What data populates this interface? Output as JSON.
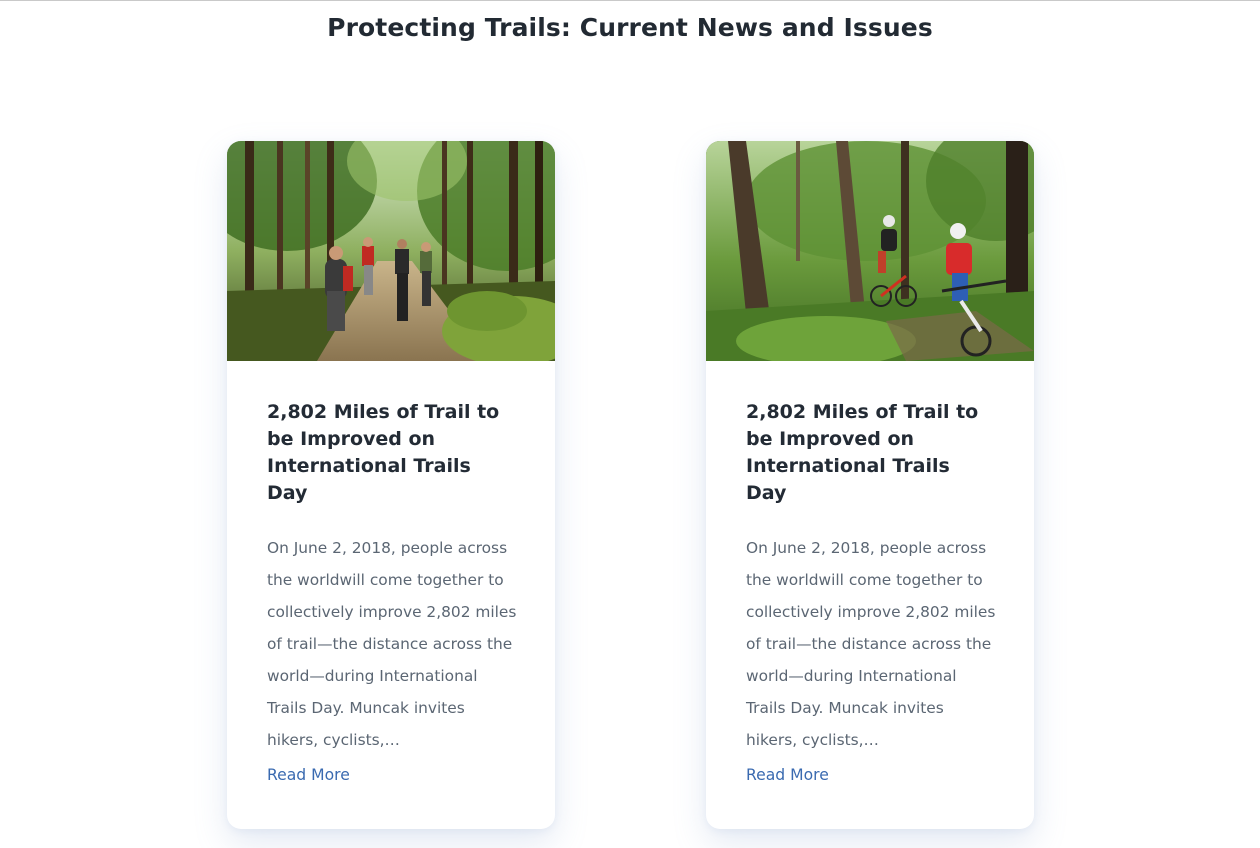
{
  "section": {
    "title": "Protecting Trails: Current News and Issues"
  },
  "cards": [
    {
      "image_label": "hikers-on-forest-trail",
      "title": "2,802 Miles of Trail to be Improved on International Trails Day",
      "excerpt": "On June 2, 2018, people across the worldwill come together to collectively improve 2,802 miles of trail—the distance across the world—during International Trails Day. Muncak invites hikers, cyclists,…",
      "link_label": "Read More"
    },
    {
      "image_label": "mountain-bikers-in-woods",
      "title": "2,802 Miles of Trail to be Improved on International Trails Day",
      "excerpt": "On June 2, 2018, people across the worldwill come together to collectively improve 2,802 miles of trail—the distance across the world—during International Trails Day. Muncak invites hikers, cyclists,…",
      "link_label": "Read More"
    }
  ],
  "colors": {
    "title": "#222a33",
    "card_title": "#232b35",
    "excerpt": "#5b6673",
    "link": "#3a6ab0"
  }
}
